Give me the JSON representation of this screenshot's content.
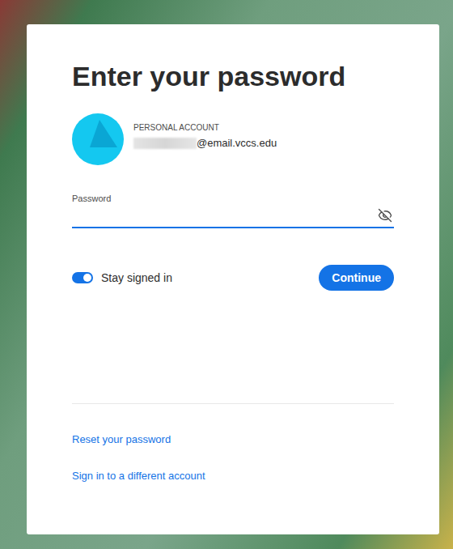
{
  "page": {
    "heading": "Enter your password"
  },
  "account": {
    "type": "PERSONAL ACCOUNT",
    "email": "@email.vccs.edu"
  },
  "password": {
    "label": "Password",
    "value": "",
    "visible": false
  },
  "stay_signed_in": {
    "label": "Stay signed in",
    "on": true
  },
  "buttons": [
    "Continue"
  ],
  "links": [
    "Reset your password",
    "Sign in to a different account"
  ]
}
